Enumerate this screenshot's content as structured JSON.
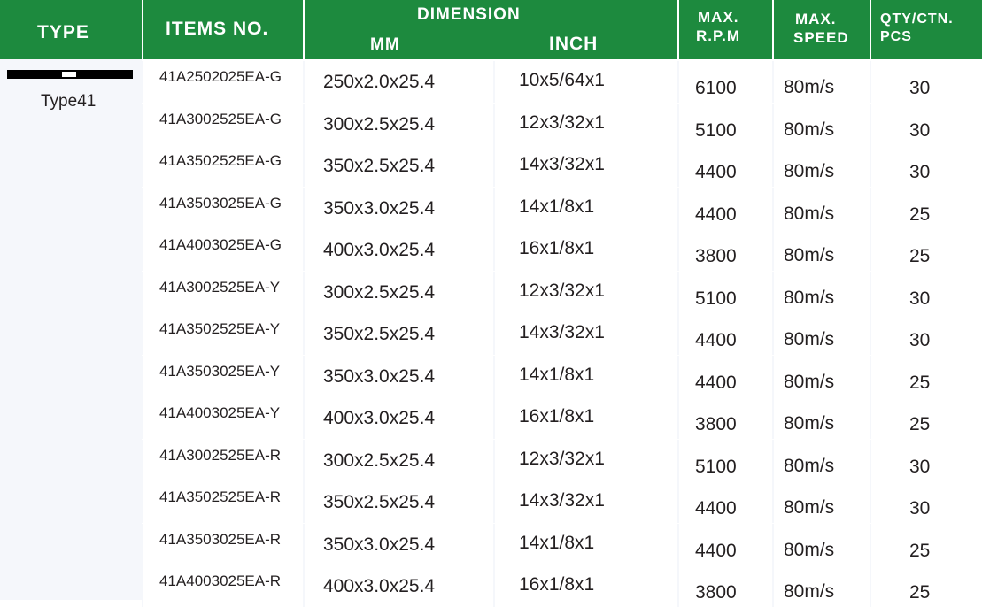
{
  "header": {
    "type": "TYPE",
    "items_no": "ITEMS NO.",
    "dimension": "DIMENSION",
    "mm": "MM",
    "inch": "INCH",
    "max_rpm_1": "MAX.",
    "max_rpm_2": "R.P.M",
    "max_speed_1": "MAX.",
    "max_speed_2": "SPEED",
    "qty_1": "QTY/CTN.",
    "qty_2": "PCS"
  },
  "type_label": "Type41",
  "colors": {
    "header_bg": "#1d8a3e",
    "row_bg": "#f5f7fb",
    "text": "#231f20"
  },
  "icons": {
    "type": "cutting-disc-profile-icon"
  },
  "rows": [
    {
      "item": "41A2502025EA-G",
      "mm": "250x2.0x25.4",
      "inch": "10x5/64x1",
      "rpm": "6100",
      "speed": "80m/s",
      "qty": "30"
    },
    {
      "item": "41A3002525EA-G",
      "mm": "300x2.5x25.4",
      "inch": "12x3/32x1",
      "rpm": "5100",
      "speed": "80m/s",
      "qty": "30"
    },
    {
      "item": "41A3502525EA-G",
      "mm": "350x2.5x25.4",
      "inch": "14x3/32x1",
      "rpm": "4400",
      "speed": "80m/s",
      "qty": "30"
    },
    {
      "item": "41A3503025EA-G",
      "mm": "350x3.0x25.4",
      "inch": "14x1/8x1",
      "rpm": "4400",
      "speed": "80m/s",
      "qty": "25"
    },
    {
      "item": "41A4003025EA-G",
      "mm": "400x3.0x25.4",
      "inch": "16x1/8x1",
      "rpm": "3800",
      "speed": "80m/s",
      "qty": "25"
    },
    {
      "item": "41A3002525EA-Y",
      "mm": "300x2.5x25.4",
      "inch": "12x3/32x1",
      "rpm": "5100",
      "speed": "80m/s",
      "qty": "30"
    },
    {
      "item": "41A3502525EA-Y",
      "mm": "350x2.5x25.4",
      "inch": "14x3/32x1",
      "rpm": "4400",
      "speed": "80m/s",
      "qty": "30"
    },
    {
      "item": "41A3503025EA-Y",
      "mm": "350x3.0x25.4",
      "inch": "14x1/8x1",
      "rpm": "4400",
      "speed": "80m/s",
      "qty": "25"
    },
    {
      "item": "41A4003025EA-Y",
      "mm": "400x3.0x25.4",
      "inch": "16x1/8x1",
      "rpm": "3800",
      "speed": "80m/s",
      "qty": "25"
    },
    {
      "item": "41A3002525EA-R",
      "mm": "300x2.5x25.4",
      "inch": "12x3/32x1",
      "rpm": "5100",
      "speed": "80m/s",
      "qty": "30"
    },
    {
      "item": "41A3502525EA-R",
      "mm": "350x2.5x25.4",
      "inch": "14x3/32x1",
      "rpm": "4400",
      "speed": "80m/s",
      "qty": "30"
    },
    {
      "item": "41A3503025EA-R",
      "mm": "350x3.0x25.4",
      "inch": "14x1/8x1",
      "rpm": "4400",
      "speed": "80m/s",
      "qty": "25"
    },
    {
      "item": "41A4003025EA-R",
      "mm": "400x3.0x25.4",
      "inch": "16x1/8x1",
      "rpm": "3800",
      "speed": "80m/s",
      "qty": "25"
    }
  ]
}
